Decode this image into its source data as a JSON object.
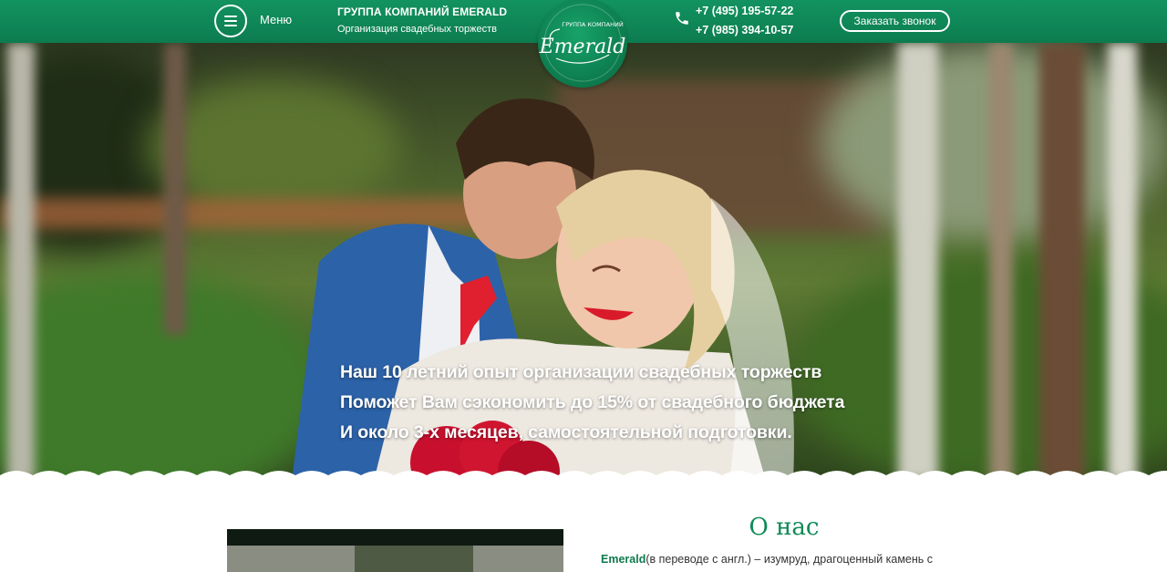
{
  "header": {
    "menu_label": "Меню",
    "company_name": "ГРУППА КОМПАНИЙ EMERALD",
    "company_sub": "Организация свадебных торжеств",
    "logo": {
      "text_top": "ГРУППА КОМПАНИЙ",
      "text_main": "Emerald"
    },
    "phones": [
      "+7 (495) 195-57-22",
      "+7 (985) 394-10-57"
    ],
    "callback_button": "Заказать звонок"
  },
  "hero": {
    "lines": [
      "Наш 10 летний опыт организации свадебных торжеств",
      "Поможет Вам сэкономить до 15% от свадебного бюджета",
      "И около 3-х месяцев, самостоятельной подготовки."
    ]
  },
  "about": {
    "title": "О нас",
    "text_strong": "Emerald",
    "text_rest": "(в переводе с англ.) – изумруд, драгоценный камень с"
  },
  "colors": {
    "brand_green": "#0f8a57",
    "header_green": "#12935f"
  },
  "icons": [
    "menu-icon",
    "phone-icon"
  ]
}
